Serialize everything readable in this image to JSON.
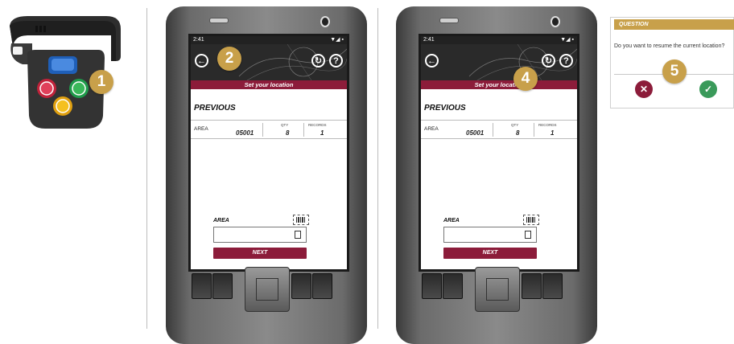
{
  "badges": [
    "1",
    "2",
    "4",
    "5"
  ],
  "phone": {
    "status_time": "2:41",
    "title": "Set your location",
    "section": "PREVIOUS",
    "row": {
      "area": "AREA",
      "code": "05001",
      "qty_label": "QTY",
      "qty": "8",
      "records_label": "RECORDS",
      "records": "1"
    },
    "area_label": "AREA",
    "next_label": "NEXT",
    "icons": [
      "back-arrow-icon",
      "refresh-icon",
      "help-icon",
      "barcode-scan-icon",
      "calculator-icon"
    ]
  },
  "dialog": {
    "header": "QUESTION",
    "text": "Do you want to resume the current location?",
    "icons": [
      "cancel-x-icon",
      "confirm-check-icon"
    ]
  },
  "colors": {
    "accent": "#8c1c3a",
    "gold": "#c8a04a",
    "cancel": "#8c1c3a",
    "confirm": "#3a9a5a"
  }
}
